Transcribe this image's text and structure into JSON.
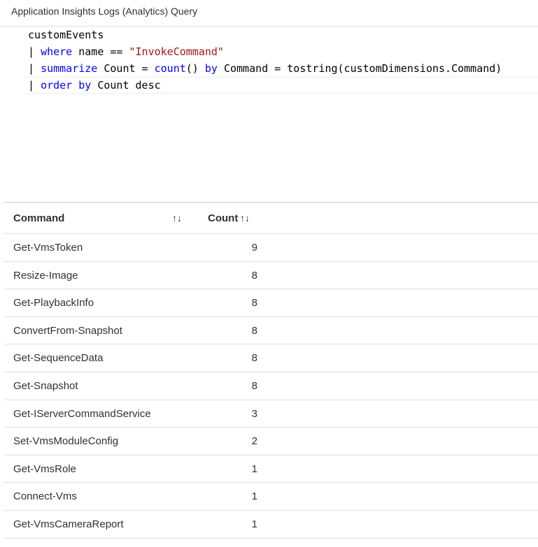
{
  "window": {
    "title": "Application Insights Logs (Analytics) Query"
  },
  "query": {
    "line1": "customEvents",
    "line2": {
      "pipe": "| ",
      "kw": "where",
      "rest1": " name == ",
      "str": "\"InvokeCommand\""
    },
    "line3": {
      "pipe": "| ",
      "kw1": "summarize",
      "rest1": " Count = ",
      "kw2": "count",
      "rest2": "() ",
      "kw3": "by",
      "rest3": " Command = tostring(customDimensions.Command)"
    },
    "line4": {
      "pipe": "| ",
      "kw": "order by",
      "rest1": " Count desc"
    }
  },
  "results": {
    "columns": {
      "command": "Command",
      "count": "Count",
      "sort_glyph": "↑↓"
    },
    "rows": [
      {
        "command": "Get-VmsToken",
        "count": "9"
      },
      {
        "command": "Resize-Image",
        "count": "8"
      },
      {
        "command": "Get-PlaybackInfo",
        "count": "8"
      },
      {
        "command": "ConvertFrom-Snapshot",
        "count": "8"
      },
      {
        "command": "Get-SequenceData",
        "count": "8"
      },
      {
        "command": "Get-Snapshot",
        "count": "8"
      },
      {
        "command": "Get-IServerCommandService",
        "count": "3"
      },
      {
        "command": "Set-VmsModuleConfig",
        "count": "2"
      },
      {
        "command": "Get-VmsRole",
        "count": "1"
      },
      {
        "command": "Connect-Vms",
        "count": "1"
      },
      {
        "command": "Get-VmsCameraReport",
        "count": "1"
      }
    ]
  },
  "colors": {
    "keyword": "#0000ff",
    "string": "#a31515",
    "text": "#323130",
    "border": "#e1dfdd"
  }
}
